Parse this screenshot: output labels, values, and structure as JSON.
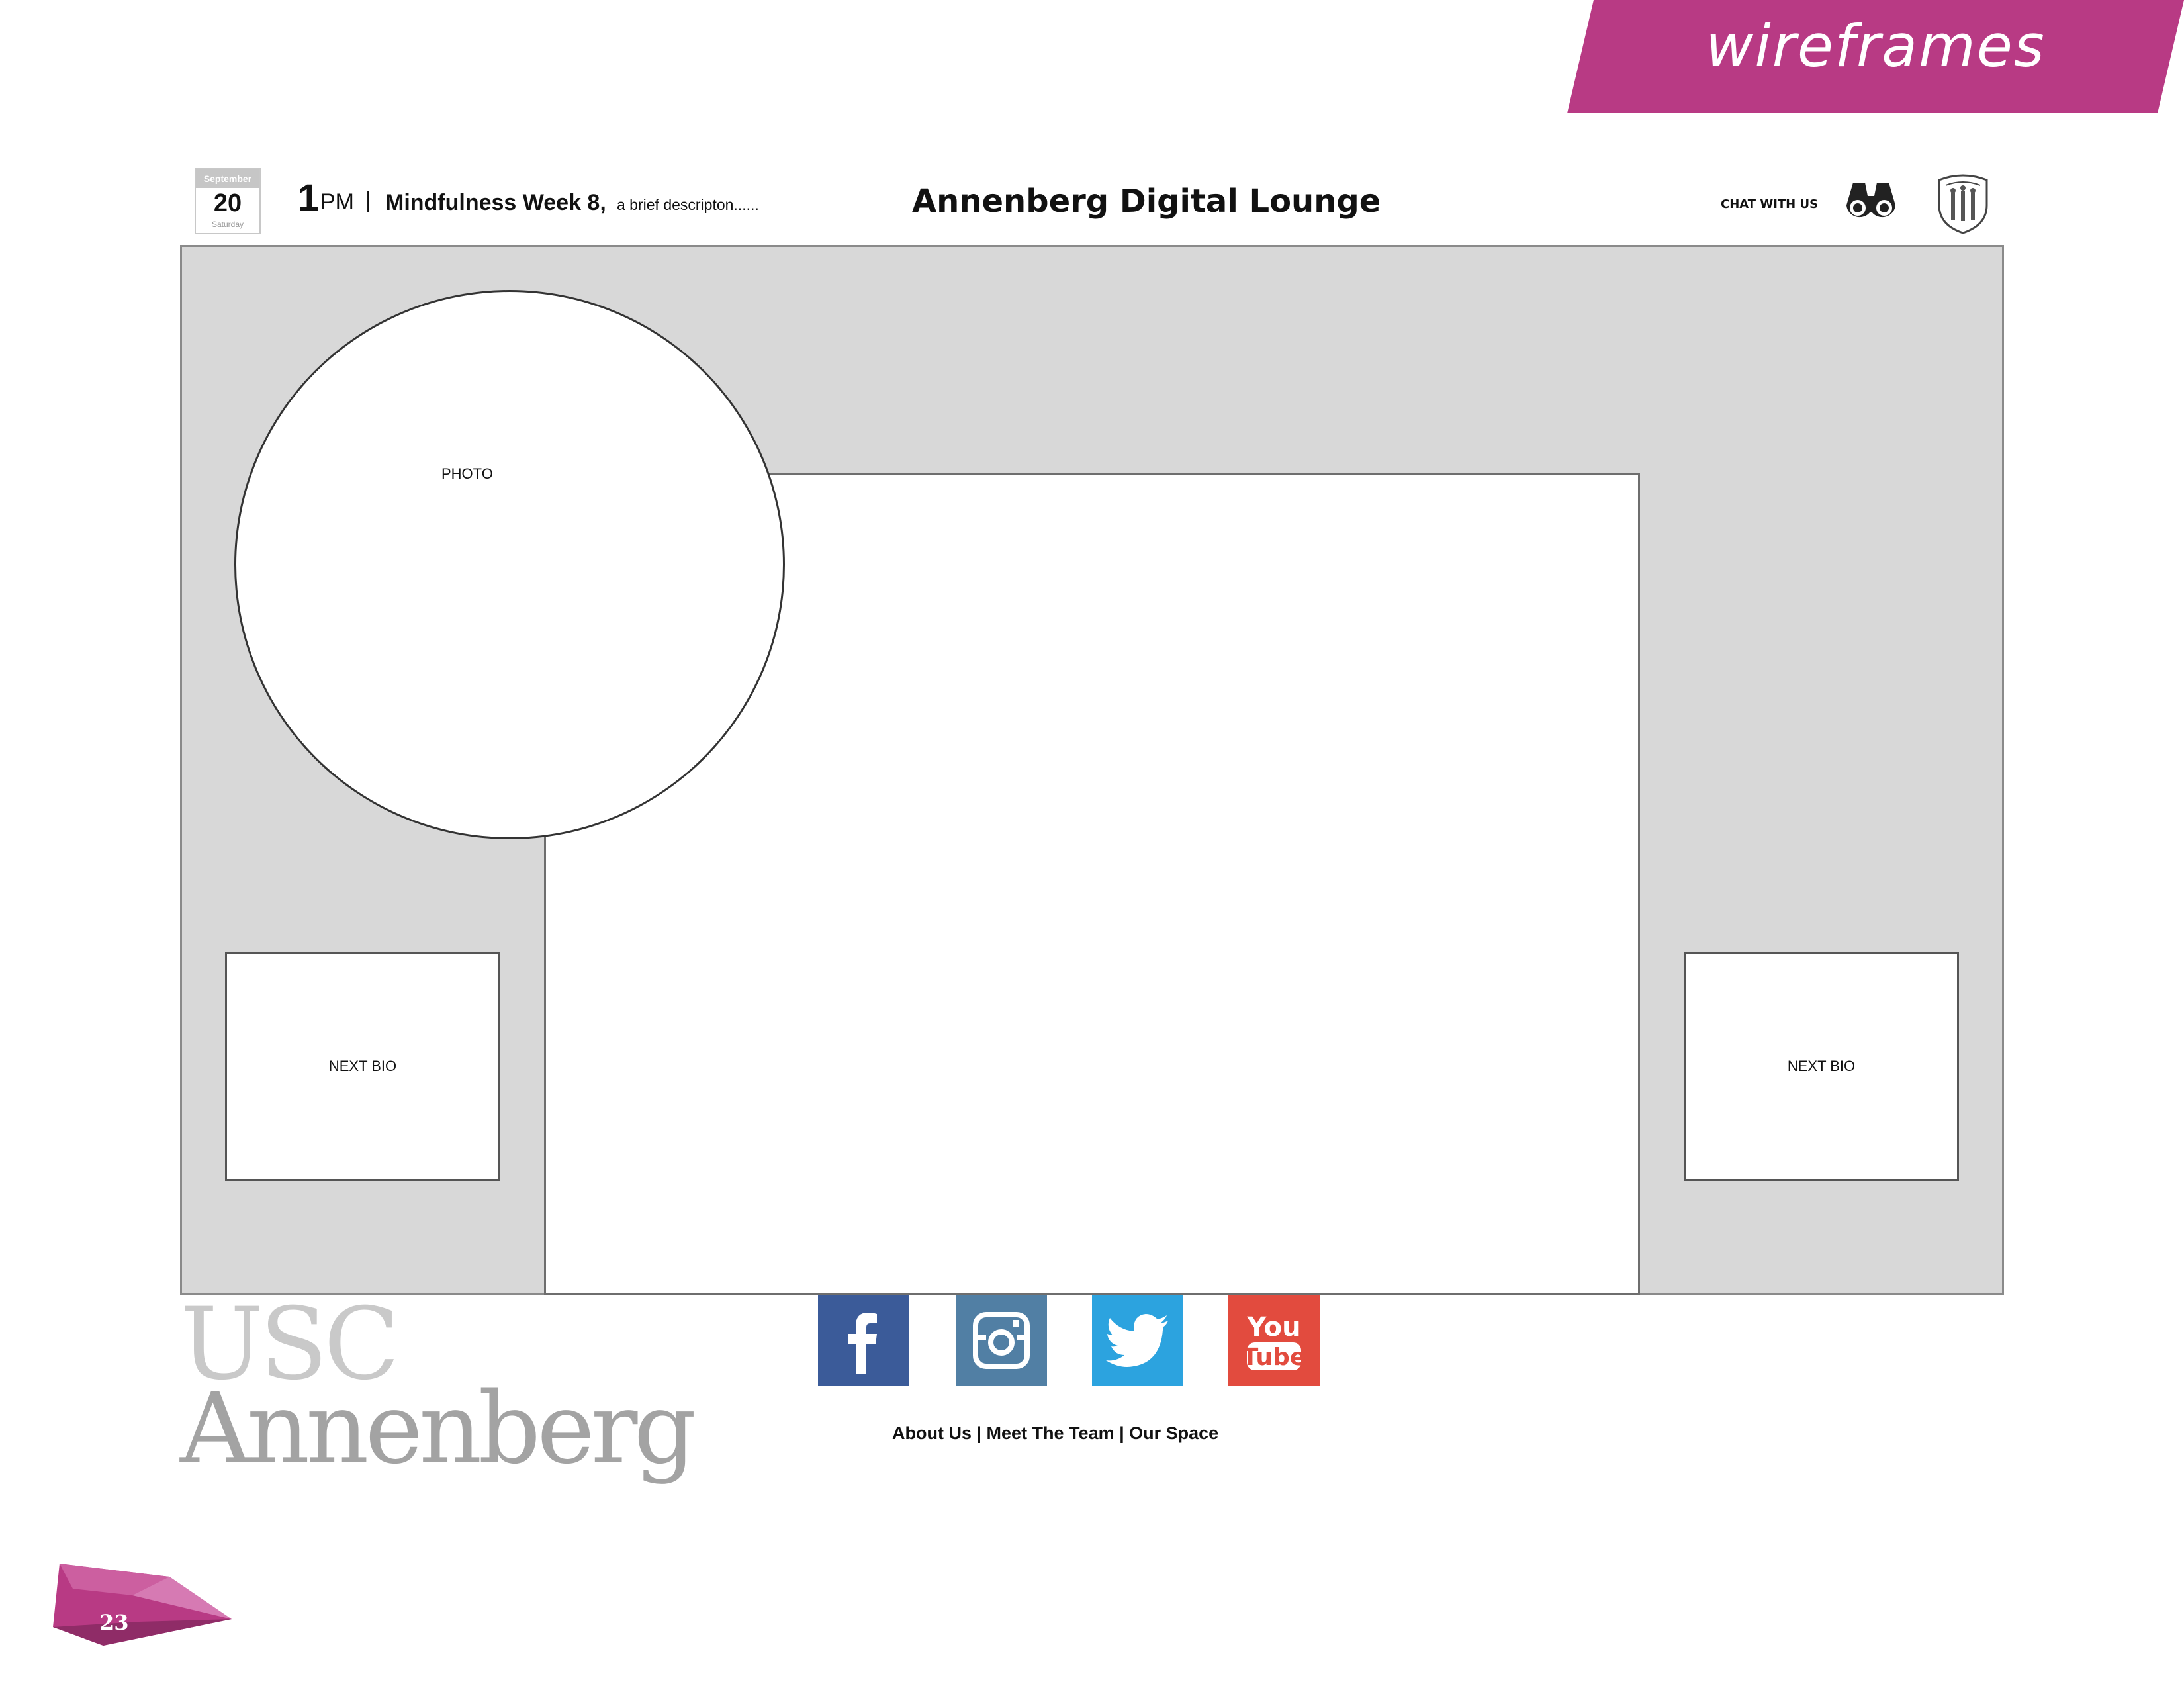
{
  "banner": {
    "label": "wireframes",
    "color": "#b83a84"
  },
  "header": {
    "calendar": {
      "month": "September",
      "day": "20",
      "weekday": "Saturday"
    },
    "time": {
      "hour": "1",
      "ampm": "PM"
    },
    "separator": "|",
    "event_title": "Mindfulness Week 8,",
    "event_description": "a brief descripton......",
    "site_title": "Annenberg Digital Lounge",
    "chat_label": "CHAT WITH US",
    "icons": [
      "binoculars-icon",
      "usc-seal-icon"
    ]
  },
  "main": {
    "photo_label": "PHOTO",
    "next_bio_left": "NEXT BIO",
    "next_bio_right": "NEXT BIO"
  },
  "footer": {
    "logo_line1": "USC",
    "logo_line2": "Annenberg",
    "social": [
      {
        "name": "facebook-icon",
        "color": "#3b5b99"
      },
      {
        "name": "instagram-icon",
        "color": "#517fa4"
      },
      {
        "name": "twitter-icon",
        "color": "#2ca3df"
      },
      {
        "name": "youtube-icon",
        "color": "#e24b3e",
        "text_top": "You",
        "text_bottom": "Tube"
      }
    ],
    "links_text": "About Us | Meet The Team | Our Space"
  },
  "page": {
    "number": "23"
  }
}
